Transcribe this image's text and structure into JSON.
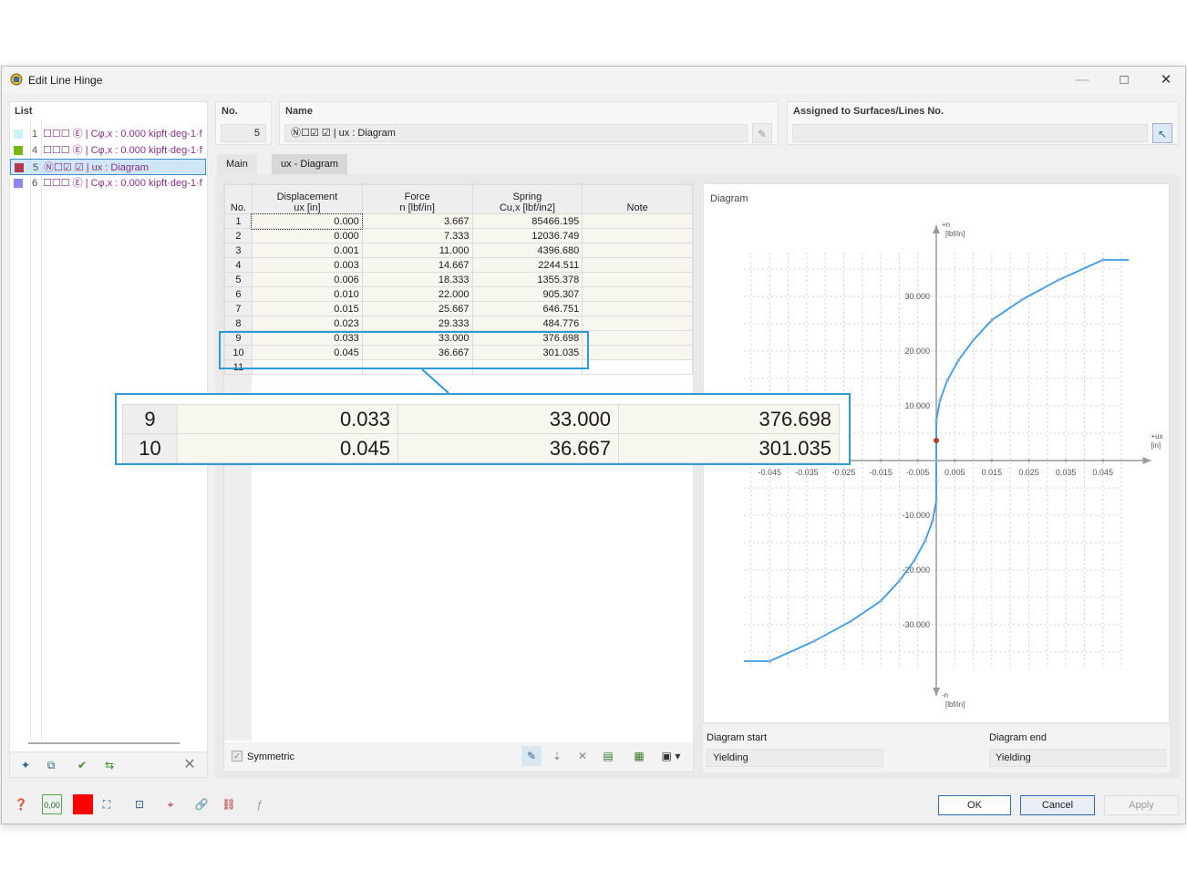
{
  "window": {
    "title": "Edit Line Hinge",
    "minimize": "—",
    "maximize": "□",
    "close": "✕"
  },
  "list": {
    "header": "List",
    "items": [
      {
        "num": "1",
        "color": "#c8f4f8",
        "text": "☐☐☐ Ⓔ | Cφ,x : 0.000 kipft·deg-1·f"
      },
      {
        "num": "4",
        "color": "#77b814",
        "text": "☐☐☐ Ⓔ | Cφ,x : 0.000 kipft·deg-1·f"
      },
      {
        "num": "5",
        "color": "#b23a4d",
        "text": "Ⓝ☐☑ ☑ | ux : Diagram"
      },
      {
        "num": "6",
        "color": "#8a86ec",
        "text": "☐☐☐ Ⓔ | Cφ,x : 0.000 kipft·deg-1·f"
      }
    ]
  },
  "no": {
    "label": "No.",
    "value": "5"
  },
  "name": {
    "label": "Name",
    "value": "Ⓝ☐☑ ☑ | ux : Diagram"
  },
  "assigned": {
    "label": "Assigned to Surfaces/Lines No.",
    "value": ""
  },
  "tabs": {
    "main": "Main",
    "diagram": "ux - Diagram"
  },
  "table": {
    "headers": {
      "no": "No.",
      "displacement": "Displacement",
      "displacement_unit": "ux [in]",
      "force": "Force",
      "force_unit": "n [lbf/in]",
      "spring": "Spring",
      "spring_unit": "Cu,x [lbf/in2]",
      "note": "Note"
    },
    "rows": [
      {
        "no": "1",
        "u": "0.000",
        "n": "3.667",
        "c": "85466.195"
      },
      {
        "no": "2",
        "u": "0.000",
        "n": "7.333",
        "c": "12036.749"
      },
      {
        "no": "3",
        "u": "0.001",
        "n": "11.000",
        "c": "4396.680"
      },
      {
        "no": "4",
        "u": "0.003",
        "n": "14.667",
        "c": "2244.511"
      },
      {
        "no": "5",
        "u": "0.006",
        "n": "18.333",
        "c": "1355.378"
      },
      {
        "no": "6",
        "u": "0.010",
        "n": "22.000",
        "c": "905.307"
      },
      {
        "no": "7",
        "u": "0.015",
        "n": "25.667",
        "c": "646.751"
      },
      {
        "no": "8",
        "u": "0.023",
        "n": "29.333",
        "c": "484.776"
      },
      {
        "no": "9",
        "u": "0.033",
        "n": "33.000",
        "c": "376.698"
      },
      {
        "no": "10",
        "u": "0.045",
        "n": "36.667",
        "c": "301.035"
      },
      {
        "no": "11",
        "u": "",
        "n": "",
        "c": ""
      }
    ],
    "symmetric": "Symmetric"
  },
  "zoom": {
    "rows": [
      {
        "no": "9",
        "u": "0.033",
        "n": "33.000",
        "c": "376.698"
      },
      {
        "no": "10",
        "u": "0.045",
        "n": "36.667",
        "c": "301.035"
      }
    ]
  },
  "diagram": {
    "title": "Diagram",
    "y_pos_label": "+n",
    "y_pos_unit": "[lbf/in]",
    "y_neg_label": "-n",
    "y_neg_unit": "[lbf/in]",
    "x_label": "+ux",
    "x_unit": "[in]",
    "start_label": "Diagram start",
    "start_value": "Yielding",
    "end_label": "Diagram end",
    "end_value": "Yielding"
  },
  "chart_data": {
    "type": "line",
    "x": [
      -0.045,
      -0.033,
      -0.023,
      -0.015,
      -0.01,
      -0.006,
      -0.003,
      -0.001,
      0.0,
      0.0,
      0,
      0.0,
      0.0,
      0.001,
      0.003,
      0.006,
      0.01,
      0.015,
      0.023,
      0.033,
      0.045
    ],
    "y": [
      -36.667,
      -33.0,
      -29.333,
      -25.667,
      -22.0,
      -18.333,
      -14.667,
      -11.0,
      -7.333,
      -3.667,
      0,
      3.667,
      7.333,
      11.0,
      14.667,
      18.333,
      22.0,
      25.667,
      29.333,
      33.0,
      36.667
    ],
    "xticks": [
      "-0.045",
      "-0.035",
      "-0.025",
      "-0.015",
      "-0.005",
      "0.005",
      "0.015",
      "0.025",
      "0.035",
      "0.045"
    ],
    "yticks": [
      "30.000",
      "20.000",
      "10.000",
      "-10.000",
      "-20.000",
      "-30.000"
    ],
    "xlim": [
      -0.052,
      0.055
    ],
    "ylim": [
      -42,
      42
    ],
    "grid": true,
    "color": "#3a9be3"
  },
  "buttons": {
    "ok": "OK",
    "cancel": "Cancel",
    "apply": "Apply"
  }
}
